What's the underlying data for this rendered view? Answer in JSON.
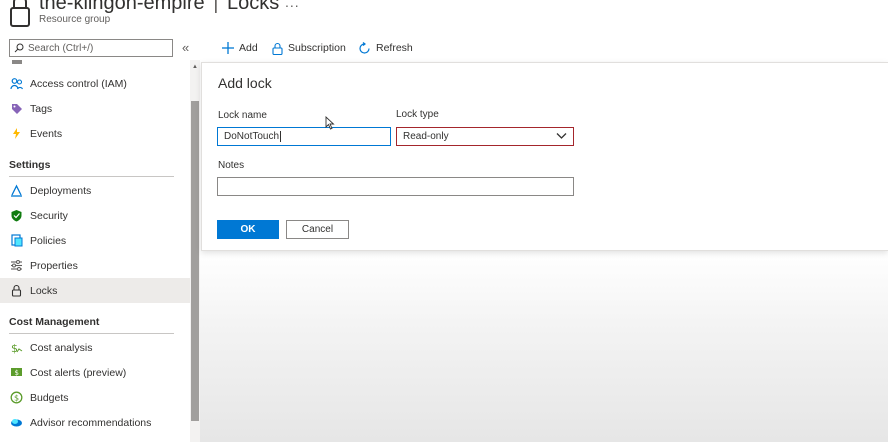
{
  "header": {
    "resource_name": "the-klingon-empire",
    "separator": "|",
    "blade_name": "Locks",
    "more": "...",
    "subtitle": "Resource group"
  },
  "search": {
    "placeholder": "Search (Ctrl+/)"
  },
  "sidebar": {
    "items_top": [
      {
        "label": "Access control (IAM)",
        "icon": "people-icon"
      },
      {
        "label": "Tags",
        "icon": "tag-icon"
      },
      {
        "label": "Events",
        "icon": "lightning-icon"
      }
    ],
    "settings_header": "Settings",
    "settings_items": [
      {
        "label": "Deployments",
        "icon": "deploy-icon"
      },
      {
        "label": "Security",
        "icon": "shield-icon"
      },
      {
        "label": "Policies",
        "icon": "policy-icon"
      },
      {
        "label": "Properties",
        "icon": "sliders-icon"
      },
      {
        "label": "Locks",
        "icon": "lock-icon",
        "selected": true
      }
    ],
    "cost_header": "Cost Management",
    "cost_items": [
      {
        "label": "Cost analysis",
        "icon": "cost-analysis-icon"
      },
      {
        "label": "Cost alerts (preview)",
        "icon": "cost-alert-icon"
      },
      {
        "label": "Budgets",
        "icon": "budget-icon"
      },
      {
        "label": "Advisor recommendations",
        "icon": "advisor-icon"
      }
    ]
  },
  "toolbar": {
    "add": "Add",
    "subscription": "Subscription",
    "refresh": "Refresh"
  },
  "form": {
    "title": "Add lock",
    "lock_name_label": "Lock name",
    "lock_name_value": "DoNotTouch",
    "lock_type_label": "Lock type",
    "lock_type_value": "Read-only",
    "notes_label": "Notes",
    "notes_value": "",
    "ok": "OK",
    "cancel": "Cancel"
  },
  "colors": {
    "accent": "#0078d4",
    "select_border": "#a4262c",
    "selected_nav": "#edebe9"
  }
}
